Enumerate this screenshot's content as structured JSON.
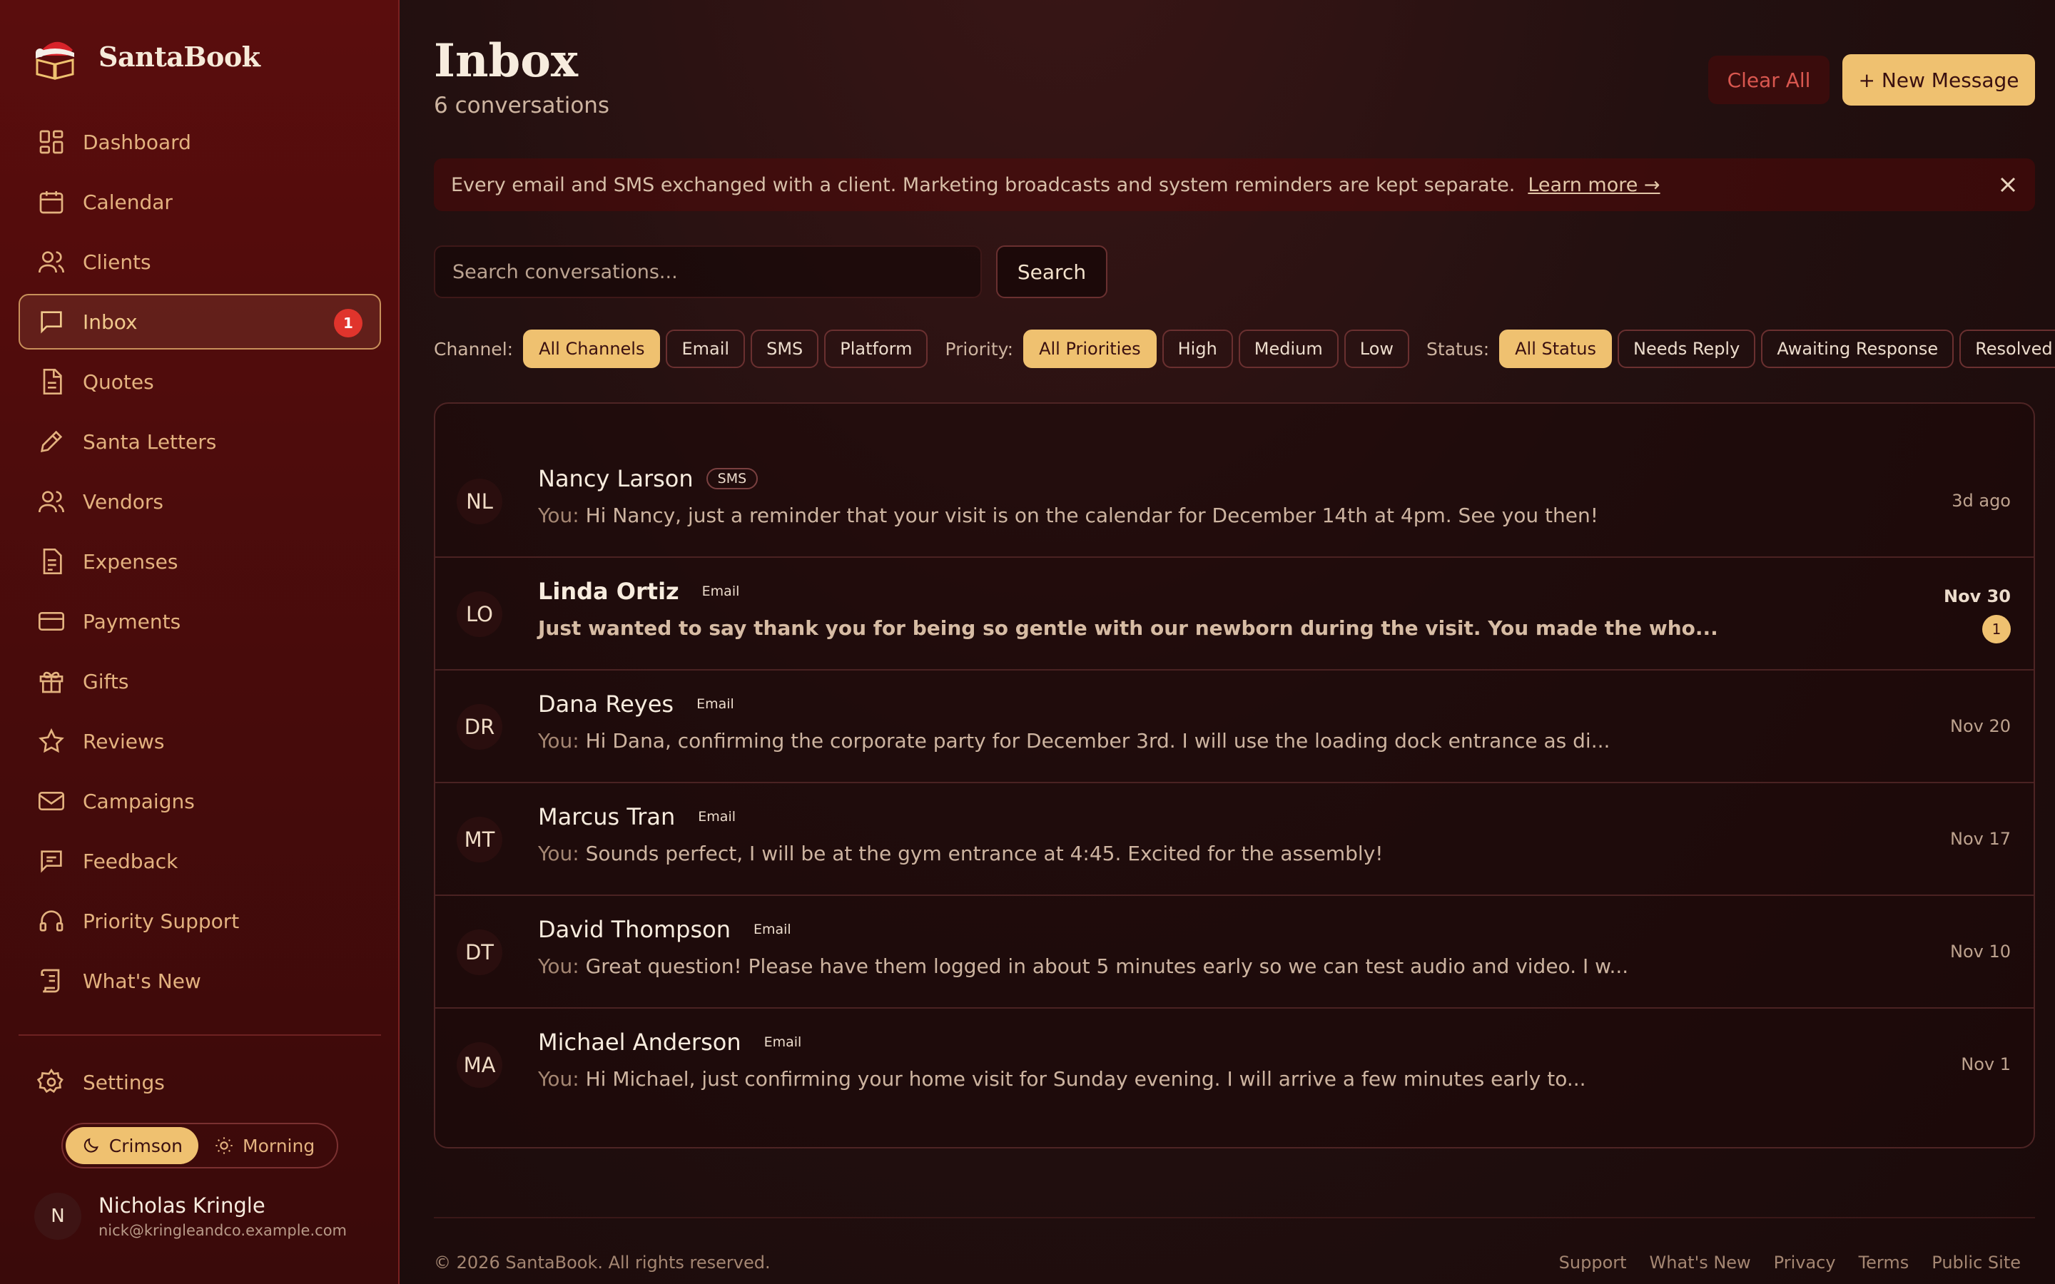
{
  "brand": {
    "name": "SantaBook"
  },
  "sidebar": {
    "items": [
      {
        "label": "Dashboard",
        "icon": "dashboard-icon"
      },
      {
        "label": "Calendar",
        "icon": "calendar-icon"
      },
      {
        "label": "Clients",
        "icon": "users-icon"
      },
      {
        "label": "Inbox",
        "icon": "message-icon",
        "badge": "1",
        "active": true
      },
      {
        "label": "Quotes",
        "icon": "document-icon"
      },
      {
        "label": "Santa Letters",
        "icon": "pen-icon"
      },
      {
        "label": "Vendors",
        "icon": "users-icon"
      },
      {
        "label": "Expenses",
        "icon": "receipt-icon"
      },
      {
        "label": "Payments",
        "icon": "credit-card-icon"
      },
      {
        "label": "Gifts",
        "icon": "gift-icon"
      },
      {
        "label": "Reviews",
        "icon": "star-icon"
      },
      {
        "label": "Campaigns",
        "icon": "mail-icon"
      },
      {
        "label": "Feedback",
        "icon": "chat-lines-icon"
      },
      {
        "label": "Priority Support",
        "icon": "headset-icon"
      },
      {
        "label": "What's New",
        "icon": "scroll-icon"
      }
    ],
    "settings_label": "Settings",
    "theme": {
      "crimson": "Crimson",
      "morning": "Morning"
    },
    "user": {
      "initial": "N",
      "name": "Nicholas Kringle",
      "email": "nick@kringleandco.example.com"
    }
  },
  "header": {
    "title": "Inbox",
    "subtitle": "6 conversations",
    "clear_label": "Clear All",
    "new_label": "+ New Message"
  },
  "banner": {
    "text": "Every email and SMS exchanged with a client. Marketing broadcasts and system reminders are kept separate.",
    "link": "Learn more →"
  },
  "search": {
    "placeholder": "Search conversations...",
    "button": "Search"
  },
  "filters": {
    "channel": {
      "label": "Channel:",
      "options": [
        "All Channels",
        "Email",
        "SMS",
        "Platform"
      ]
    },
    "priority": {
      "label": "Priority:",
      "options": [
        "All Priorities",
        "High",
        "Medium",
        "Low"
      ]
    },
    "status": {
      "label": "Status:",
      "options": [
        "All Status",
        "Needs Reply",
        "Awaiting Response",
        "Resolved"
      ]
    }
  },
  "conversations": [
    {
      "initials": "NL",
      "name": "Nancy Larson",
      "channel": "SMS",
      "you": "You:",
      "preview": "Hi Nancy, just a reminder that your visit is on the calendar for December 14th at 4pm. See you then!",
      "time": "3d ago"
    },
    {
      "initials": "LO",
      "name": "Linda Ortiz",
      "channel": "Email",
      "you": "",
      "preview": "Just wanted to say thank you for being so gentle with our newborn during the visit. You made the who...",
      "time": "Nov 30",
      "unread": "1"
    },
    {
      "initials": "DR",
      "name": "Dana Reyes",
      "channel": "Email",
      "you": "You:",
      "preview": "Hi Dana, confirming the corporate party for December 3rd. I will use the loading dock entrance as di...",
      "time": "Nov 20"
    },
    {
      "initials": "MT",
      "name": "Marcus Tran",
      "channel": "Email",
      "you": "You:",
      "preview": "Sounds perfect, I will be at the gym entrance at 4:45. Excited for the assembly!",
      "time": "Nov 17"
    },
    {
      "initials": "DT",
      "name": "David Thompson",
      "channel": "Email",
      "you": "You:",
      "preview": "Great question! Please have them logged in about 5 minutes early so we can test audio and video. I w...",
      "time": "Nov 10"
    },
    {
      "initials": "MA",
      "name": "Michael Anderson",
      "channel": "Email",
      "you": "You:",
      "preview": "Hi Michael, just confirming your home visit for Sunday evening. I will arrive a few minutes early to...",
      "time": "Nov 1"
    }
  ],
  "footer": {
    "copyright": "© 2026 SantaBook. All rights reserved.",
    "links": [
      "Support",
      "What's New",
      "Privacy",
      "Terms",
      "Public Site"
    ]
  },
  "colors": {
    "accent": "#efc170",
    "danger": "#e0342c",
    "sidebar": "#5a0d0d",
    "background": "#1c0b0b"
  }
}
